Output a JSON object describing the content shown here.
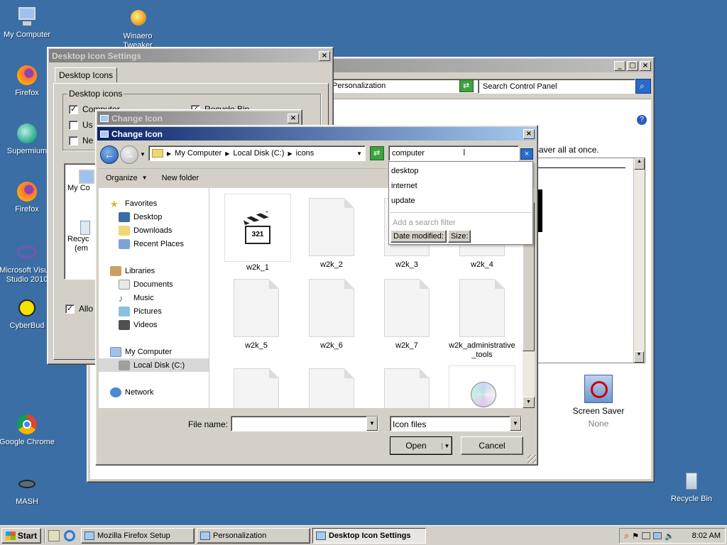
{
  "desktop": {
    "icons": [
      {
        "label": "My Computer"
      },
      {
        "label": "Winaero Tweaker"
      },
      {
        "label": "Firefox"
      },
      {
        "label": "Supermium"
      },
      {
        "label": "Firefox"
      },
      {
        "label": "Microsoft Visual Studio 2010"
      },
      {
        "label": "CyberBud"
      },
      {
        "label": "Google Chrome"
      },
      {
        "label": "MASH"
      },
      {
        "label": "Recycle Bin"
      }
    ]
  },
  "personalization": {
    "address": "Personalization",
    "search_placeholder": "Search Control Panel",
    "text_fragment": "saver all at once.",
    "screen_saver_label": "Screen Saver",
    "screen_saver_value": "None"
  },
  "desktop_icon_settings": {
    "title": "Desktop Icon Settings",
    "tab": "Desktop Icons",
    "group": "Desktop icons",
    "chk_computer": "Computer",
    "chk_recycle": "Recycle Bin",
    "chk_user": "Us",
    "chk_network": "Ne",
    "preview_mycomputer": "My Co",
    "preview_recycle": "Recyc",
    "preview_recycle2": "(em",
    "allow": "Allo"
  },
  "change_icon_back": {
    "title": "Change Icon"
  },
  "change_icon": {
    "title": "Change Icon",
    "breadcrumb": [
      "My Computer",
      "Local Disk (C:)",
      "icons"
    ],
    "search_value": "computer",
    "suggestions": [
      "desktop",
      "internet",
      "update"
    ],
    "filter_hint": "Add a search filter",
    "filter_date": "Date modified:",
    "filter_size": "Size:",
    "organize": "Organize",
    "new_folder": "New folder",
    "nav": {
      "favorites": "Favorites",
      "desktop": "Desktop",
      "downloads": "Downloads",
      "recent": "Recent Places",
      "libraries": "Libraries",
      "documents": "Documents",
      "music": "Music",
      "pictures": "Pictures",
      "videos": "Videos",
      "mycomputer": "My Computer",
      "localdisk": "Local Disk (C:)",
      "network": "Network"
    },
    "files": [
      "w2k_1",
      "w2k_2",
      "w2k_3",
      "w2k_4",
      "w2k_5",
      "w2k_6",
      "w2k_7",
      "w2k_administrative_tools"
    ],
    "filename_label": "File name:",
    "filetype": "Icon files",
    "open": "Open",
    "cancel": "Cancel"
  },
  "taskbar": {
    "start": "Start",
    "tasks": [
      "Mozilla Firefox Setup",
      "Personalization",
      "Desktop Icon Settings"
    ],
    "time": "8:02 AM"
  }
}
